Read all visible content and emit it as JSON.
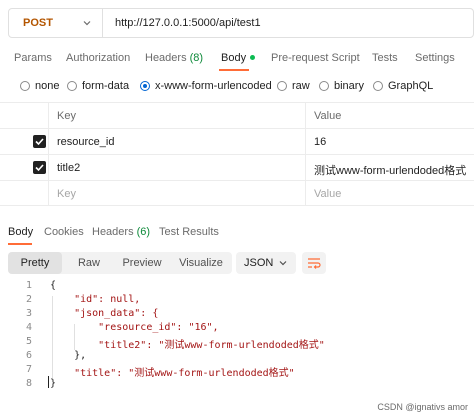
{
  "request": {
    "method": "POST",
    "url": "http://127.0.0.1:5000/api/test1"
  },
  "request_tabs": [
    {
      "label": "Params"
    },
    {
      "label": "Authorization"
    },
    {
      "label": "Headers",
      "count": "(8)"
    },
    {
      "label": "Body",
      "active": true
    },
    {
      "label": "Pre-request Script"
    },
    {
      "label": "Tests"
    },
    {
      "label": "Settings"
    }
  ],
  "body_types": [
    {
      "label": "none",
      "selected": false
    },
    {
      "label": "form-data",
      "selected": false
    },
    {
      "label": "x-www-form-urlencoded",
      "selected": true
    },
    {
      "label": "raw",
      "selected": false
    },
    {
      "label": "binary",
      "selected": false
    },
    {
      "label": "GraphQL",
      "selected": false
    }
  ],
  "kv_table": {
    "headers": {
      "key": "Key",
      "value": "Value"
    },
    "rows": [
      {
        "key": "resource_id",
        "value": "16",
        "checked": true
      },
      {
        "key": "title2",
        "value": "测试www-form-urlendoded格式",
        "checked": true
      }
    ],
    "placeholder": {
      "key": "Key",
      "value": "Value"
    }
  },
  "response_tabs": [
    {
      "label": "Body",
      "active": true
    },
    {
      "label": "Cookies"
    },
    {
      "label": "Headers",
      "count": "(6)"
    },
    {
      "label": "Test Results"
    }
  ],
  "view_modes": [
    "Pretty",
    "Raw",
    "Preview",
    "Visualize"
  ],
  "active_view": "Pretty",
  "format": "JSON",
  "code_lines": [
    {
      "n": "1",
      "text": "{"
    },
    {
      "n": "2",
      "text": "    \"id\": null,"
    },
    {
      "n": "3",
      "text": "    \"json_data\": {"
    },
    {
      "n": "4",
      "text": "        \"resource_id\": \"16\","
    },
    {
      "n": "5",
      "text": "        \"title2\": \"测试www-form-urlendoded格式\""
    },
    {
      "n": "6",
      "text": "    },"
    },
    {
      "n": "7",
      "text": "    \"title\": \"测试www-form-urlendoded格式\""
    },
    {
      "n": "8",
      "text": "}"
    }
  ],
  "watermark": "CSDN @ignativs  amor",
  "colors": {
    "accent": "#ff6c37",
    "method": "#b35500",
    "selected_radio": "#0265d2",
    "status_dot": "#0cbb52"
  },
  "icons": [
    "chevron-down-icon",
    "checkbox-checked-icon",
    "wrap-lines-icon"
  ]
}
